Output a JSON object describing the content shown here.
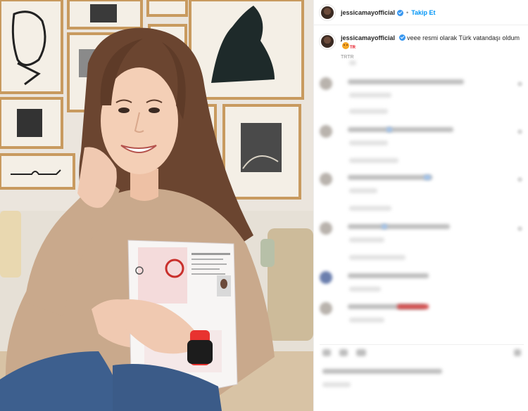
{
  "post": {
    "username": "jessicamayofficial",
    "follow_label": "Takip Et",
    "dot": "•",
    "caption_text": "veee resmi olarak Türk vatandaşı oldum",
    "caption_flag": "TR",
    "caption_sub": "TRTR"
  },
  "colors": {
    "accent": "#0095f6",
    "verified": "#3897f0",
    "watch_band": "#e8322f"
  },
  "icons": {
    "verified": "verified-badge-icon",
    "emoji": "emoji-icon"
  }
}
